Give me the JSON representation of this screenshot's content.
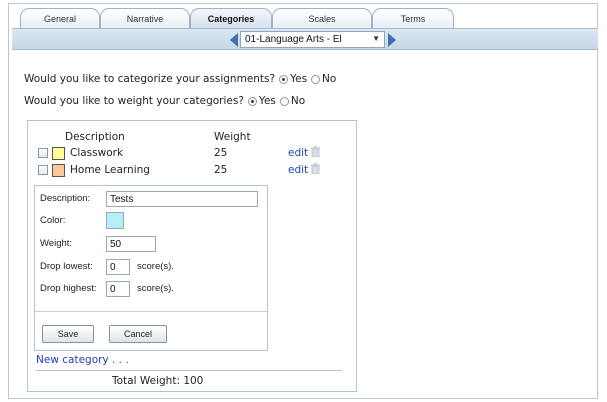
{
  "tabs": [
    {
      "label": "General",
      "active": false
    },
    {
      "label": "Narrative",
      "active": false
    },
    {
      "label": "Categories",
      "active": true
    },
    {
      "label": "Scales",
      "active": false
    },
    {
      "label": "Terms",
      "active": false
    }
  ],
  "course_selector": {
    "value": "01-Language Arts - El"
  },
  "questions": {
    "categorize": {
      "text": "Would you like to categorize your assignments?",
      "yes": "Yes",
      "no": "No",
      "selected": "Yes"
    },
    "weight": {
      "text": "Would you like to weight your categories?",
      "yes": "Yes",
      "no": "No",
      "selected": "Yes"
    }
  },
  "categories": {
    "header_description": "Description",
    "header_weight": "Weight",
    "items": [
      {
        "name": "Classwork",
        "weight": "25",
        "color": "#ffff99",
        "edit": "edit"
      },
      {
        "name": "Home Learning",
        "weight": "25",
        "color": "#fcc998",
        "edit": "edit"
      }
    ],
    "new_category": "New category . . .",
    "total": "Total Weight: 100"
  },
  "form": {
    "description_label": "Description:",
    "description_value": "Tests",
    "color_label": "Color:",
    "color_value": "#b3f0f6",
    "weight_label": "Weight:",
    "weight_value": "50",
    "drop_lowest_label": "Drop lowest:",
    "drop_lowest_value": "0",
    "drop_highest_label": "Drop highest:",
    "drop_highest_value": "0",
    "score_suffix": "score(s).",
    "save": "Save",
    "cancel": "Cancel"
  },
  "icons": {
    "trash": "trash-icon",
    "prev": "arrow-left-icon",
    "next": "arrow-right-icon",
    "dropdown": "chevron-down-icon"
  }
}
